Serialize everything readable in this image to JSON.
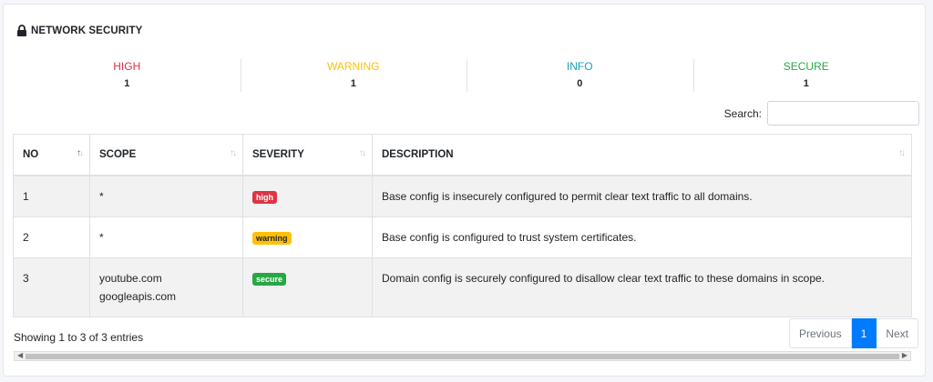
{
  "section": {
    "title": "NETWORK SECURITY"
  },
  "stats": [
    {
      "label": "HIGH",
      "count": "1",
      "color": "#dc3545"
    },
    {
      "label": "WARNING",
      "count": "1",
      "color": "#ffc107"
    },
    {
      "label": "INFO",
      "count": "0",
      "color": "#17a2b8"
    },
    {
      "label": "SECURE",
      "count": "1",
      "color": "#28a745"
    }
  ],
  "search": {
    "label": "Search:",
    "value": ""
  },
  "table": {
    "headers": [
      "NO",
      "SCOPE",
      "SEVERITY",
      "DESCRIPTION"
    ],
    "rows": [
      {
        "no": "1",
        "scope": [
          "*"
        ],
        "severity": "high",
        "severity_color": "#dc3545",
        "severity_text_color": "#ffffff",
        "description": "Base config is insecurely configured to permit clear text traffic to all domains."
      },
      {
        "no": "2",
        "scope": [
          "*"
        ],
        "severity": "warning",
        "severity_color": "#ffc107",
        "severity_text_color": "#212529",
        "description": "Base config is configured to trust system certificates."
      },
      {
        "no": "3",
        "scope": [
          "youtube.com",
          "googleapis.com"
        ],
        "severity": "secure",
        "severity_color": "#28a745",
        "severity_text_color": "#ffffff",
        "description": "Domain config is securely configured to disallow clear text traffic to these domains in scope."
      }
    ]
  },
  "footer": {
    "info": "Showing 1 to 3 of 3 entries",
    "previous": "Previous",
    "current_page": "1",
    "next": "Next"
  }
}
